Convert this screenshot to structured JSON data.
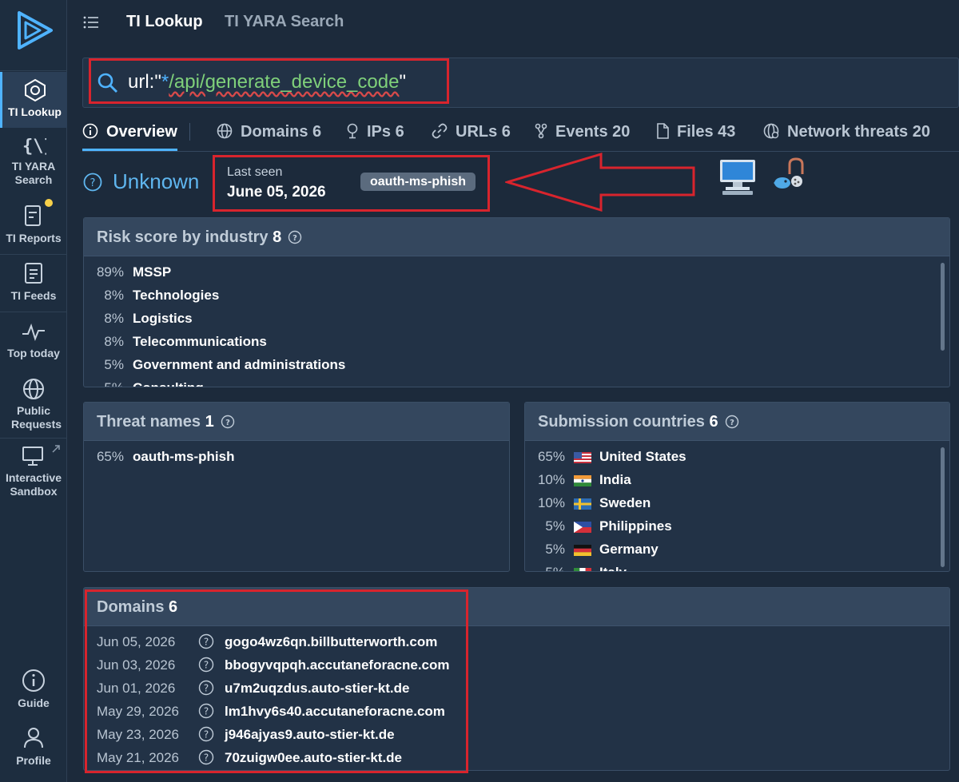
{
  "sidebar": {
    "items": [
      {
        "label": "TI Lookup",
        "icon": "hexagon-network-icon"
      },
      {
        "label": "TI YARA Search",
        "icon": "curly-braces-icon"
      },
      {
        "label": "TI Reports",
        "icon": "report-icon"
      },
      {
        "label": "TI Feeds",
        "icon": "feed-icon"
      },
      {
        "label": "Top today",
        "icon": "pulse-icon"
      },
      {
        "label": "Public Requests",
        "icon": "globe-icon"
      },
      {
        "label": "Interactive Sandbox",
        "icon": "monitor-icon"
      },
      {
        "label": "Guide",
        "icon": "info-icon"
      },
      {
        "label": "Profile",
        "icon": "user-icon"
      }
    ]
  },
  "header": {
    "tabs": [
      {
        "label": "TI Lookup",
        "active": true
      },
      {
        "label": "TI YARA Search",
        "active": false
      }
    ]
  },
  "search": {
    "prefix": "url:\"",
    "star": "*",
    "path": "/api/generate_device_code",
    "suffix": "\""
  },
  "subtabs": [
    {
      "label": "Overview",
      "icon": "info-icon"
    },
    {
      "label": "Domains 6",
      "icon": "globe-icon"
    },
    {
      "label": "IPs 6",
      "icon": "pin-icon"
    },
    {
      "label": "URLs 6",
      "icon": "link-icon"
    },
    {
      "label": "Events 20",
      "icon": "branch-icon"
    },
    {
      "label": "Files 43",
      "icon": "file-icon"
    },
    {
      "label": "Network threats 20",
      "icon": "network-icon"
    }
  ],
  "verdict": {
    "label": "Unknown",
    "last_seen_label": "Last seen",
    "last_seen_value": "June 05, 2026",
    "tag": "oauth-ms-phish"
  },
  "risk": {
    "title": "Risk score by industry",
    "count": "8",
    "rows": [
      {
        "pct": "89%",
        "name": "MSSP"
      },
      {
        "pct": "8%",
        "name": "Technologies"
      },
      {
        "pct": "8%",
        "name": "Logistics"
      },
      {
        "pct": "8%",
        "name": "Telecommunications"
      },
      {
        "pct": "5%",
        "name": "Government and administrations"
      },
      {
        "pct": "5%",
        "name": "Consulting"
      }
    ]
  },
  "threats": {
    "title": "Threat names",
    "count": "1",
    "rows": [
      {
        "pct": "65%",
        "name": "oauth-ms-phish"
      }
    ]
  },
  "countries": {
    "title": "Submission countries",
    "count": "6",
    "rows": [
      {
        "pct": "65%",
        "name": "United States",
        "flag": "us"
      },
      {
        "pct": "10%",
        "name": "India",
        "flag": "in"
      },
      {
        "pct": "10%",
        "name": "Sweden",
        "flag": "se"
      },
      {
        "pct": "5%",
        "name": "Philippines",
        "flag": "ph"
      },
      {
        "pct": "5%",
        "name": "Germany",
        "flag": "de"
      },
      {
        "pct": "5%",
        "name": "Italy",
        "flag": "it"
      }
    ]
  },
  "domains": {
    "title": "Domains",
    "count": "6",
    "rows": [
      {
        "date": "Jun 05, 2026",
        "domain": "gogo4wz6qn.billbutterworth.com"
      },
      {
        "date": "Jun 03, 2026",
        "domain": "bbogyvqpqh.accutaneforacne.com"
      },
      {
        "date": "Jun 01, 2026",
        "domain": "u7m2uqzdus.auto-stier-kt.de"
      },
      {
        "date": "May 29, 2026",
        "domain": "lm1hvy6s40.accutaneforacne.com"
      },
      {
        "date": "May 23, 2026",
        "domain": "j946ajyas9.auto-stier-kt.de"
      },
      {
        "date": "May 21, 2026",
        "domain": "70zuigw0ee.auto-stier-kt.de"
      }
    ]
  },
  "colors": {
    "accent": "#4fb3ff",
    "annotation_red": "#d8242d",
    "background": "#1c2a3b"
  }
}
